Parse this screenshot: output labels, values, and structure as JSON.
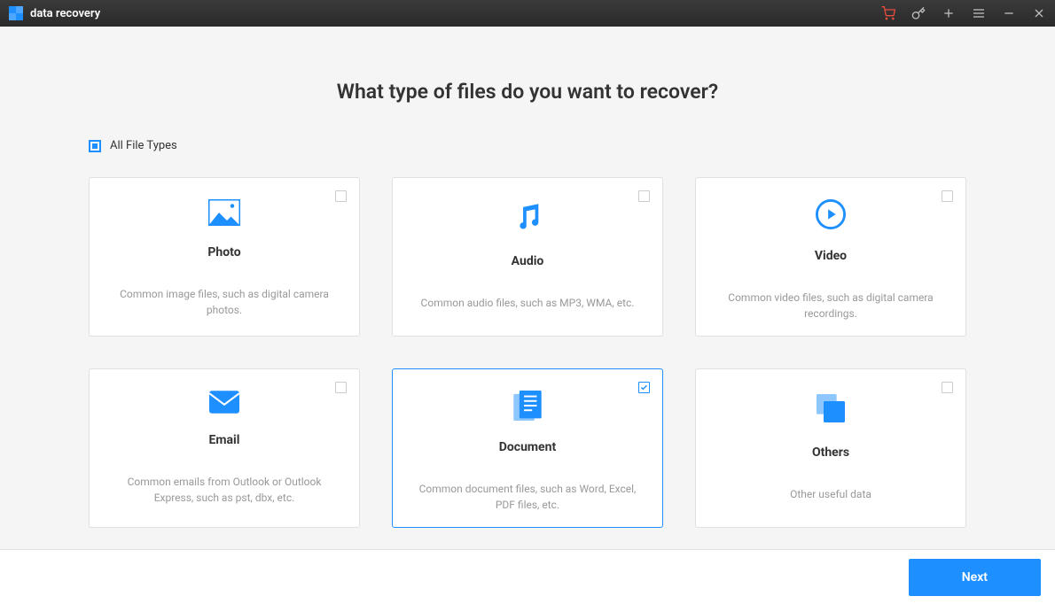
{
  "app": {
    "title": "data recovery"
  },
  "main": {
    "heading": "What type of files do you want to recover?",
    "all_types_label": "All File Types"
  },
  "cards": {
    "photo": {
      "title": "Photo",
      "desc": "Common image files, such as digital camera photos."
    },
    "audio": {
      "title": "Audio",
      "desc": "Common audio files, such as MP3, WMA, etc."
    },
    "video": {
      "title": "Video",
      "desc": "Common video files, such as digital camera recordings."
    },
    "email": {
      "title": "Email",
      "desc": "Common emails from Outlook or Outlook Express, such as pst, dbx, etc."
    },
    "document": {
      "title": "Document",
      "desc": "Common document files, such as Word, Excel, PDF files, etc."
    },
    "others": {
      "title": "Others",
      "desc": "Other useful data"
    }
  },
  "footer": {
    "next_label": "Next"
  }
}
